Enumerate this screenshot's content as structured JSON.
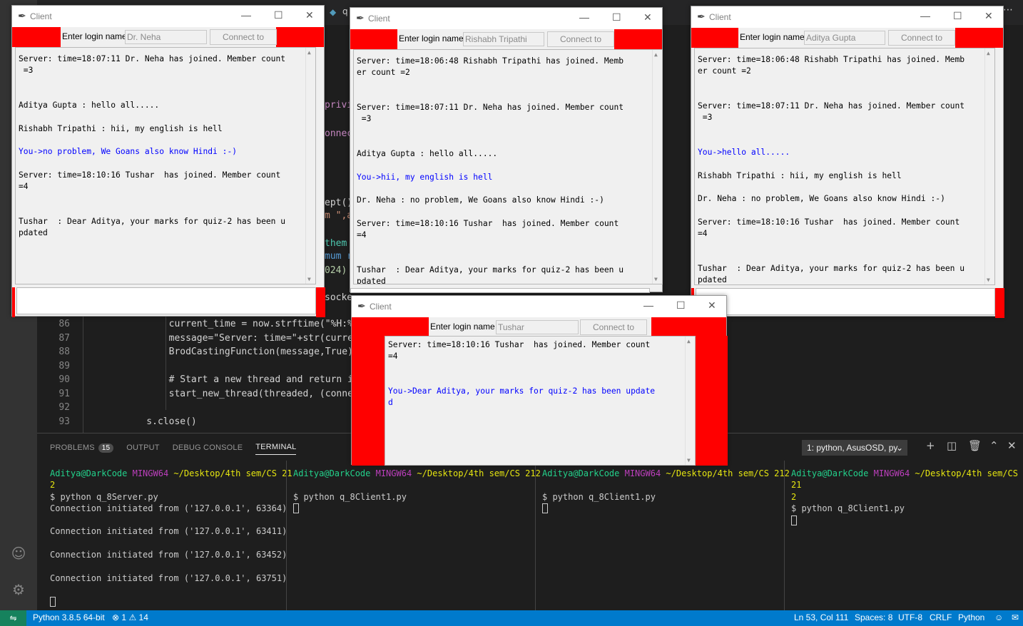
{
  "vscode": {
    "partial_tab": "q",
    "code_lines": [
      {
        "num": "86",
        "text": "        current_time = now.strftime(\"%H:%M:%"
      },
      {
        "num": "87",
        "text": "        message=\"Server: time=\"+str(current_"
      },
      {
        "num": "88",
        "text": "        BrodCastingFunction(message,True)"
      },
      {
        "num": "89",
        "text": ""
      },
      {
        "num": "90",
        "text": "        # Start a new thread and return its"
      },
      {
        "num": "91",
        "text": "        start_new_thread(threaded, (connecti"
      },
      {
        "num": "92",
        "text": ""
      },
      {
        "num": "93",
        "text": "    s.close()"
      }
    ],
    "peek_fragments": [
      "privi",
      "onnec",
      "ept()",
      "m \",a",
      "them",
      "mum r",
      "024)",
      "socke"
    ],
    "panel": {
      "tabs": [
        {
          "label": "PROBLEMS",
          "badge": "15"
        },
        {
          "label": "OUTPUT"
        },
        {
          "label": "DEBUG CONSOLE"
        },
        {
          "label": "TERMINAL"
        }
      ],
      "terminal_select": "1: python, AsusOSD, py",
      "icons": [
        "plus-icon",
        "split-icon",
        "trash-icon",
        "chevron-up-icon",
        "close-icon"
      ]
    },
    "terminals": [
      {
        "user": "Aditya@DarkCode",
        "env": "MINGW64",
        "path": "~/Desktop/4th sem/CS 21",
        "path_wrap": "2",
        "command": "$ python q_8Server.py",
        "output": [
          "Connection initiated from  ('127.0.0.1', 63364)",
          "Connection initiated from  ('127.0.0.1', 63411)",
          "Connection initiated from  ('127.0.0.1', 63452)",
          "Connection initiated from  ('127.0.0.1', 63751)"
        ]
      },
      {
        "user": "Aditya@DarkCode",
        "env": "MINGW64",
        "path": "~/Desktop/4th sem/CS 212",
        "command": "$ python q_8Client1.py"
      },
      {
        "user": "Aditya@DarkCode",
        "env": "MINGW64",
        "path": "~/Desktop/4th sem/CS 212",
        "command": "$ python q_8Client1.py"
      },
      {
        "user": "Aditya@DarkCode",
        "env": "MINGW64",
        "path": "~/Desktop/4th sem/CS 21",
        "path_wrap": "2",
        "command": "$ python q_8Client1.py"
      }
    ],
    "status": {
      "python": "Python 3.8.5 64-bit",
      "errors": "1",
      "warnings": "14",
      "position": "Ln 53, Col 111",
      "spaces": "Spaces: 8",
      "encoding": "UTF-8",
      "eol": "CRLF",
      "language": "Python"
    }
  },
  "client_common": {
    "title": "Client",
    "login_label": "Enter login name",
    "connect_label": "Connect to server"
  },
  "clients": [
    {
      "login_value": "Dr. Neha",
      "lines": [
        {
          "t": "Server: time=18:07:11 Dr. Neha has joined. Member count"
        },
        {
          "t": " =3"
        },
        {
          "t": ""
        },
        {
          "t": ""
        },
        {
          "t": "Aditya Gupta : hello all....."
        },
        {
          "t": ""
        },
        {
          "t": "Rishabh Tripathi : hii, my english is hell"
        },
        {
          "t": ""
        },
        {
          "t": "You->no problem, We Goans also know Hindi :-)",
          "you": true
        },
        {
          "t": ""
        },
        {
          "t": "Server: time=18:10:16 Tushar  has joined. Member count"
        },
        {
          "t": "=4"
        },
        {
          "t": ""
        },
        {
          "t": ""
        },
        {
          "t": "Tushar  : Dear Aditya, your marks for quiz-2 has been u"
        },
        {
          "t": "pdated"
        }
      ]
    },
    {
      "login_value": "Rishabh Tripathi",
      "lines": [
        {
          "t": "Server: time=18:06:48 Rishabh Tripathi has joined. Memb"
        },
        {
          "t": "er count =2"
        },
        {
          "t": ""
        },
        {
          "t": ""
        },
        {
          "t": "Server: time=18:07:11 Dr. Neha has joined. Member count"
        },
        {
          "t": " =3"
        },
        {
          "t": ""
        },
        {
          "t": ""
        },
        {
          "t": "Aditya Gupta : hello all....."
        },
        {
          "t": ""
        },
        {
          "t": "You->hii, my english is hell",
          "you": true
        },
        {
          "t": ""
        },
        {
          "t": "Dr. Neha : no problem, We Goans also know Hindi :-)"
        },
        {
          "t": ""
        },
        {
          "t": "Server: time=18:10:16 Tushar  has joined. Member count"
        },
        {
          "t": "=4"
        },
        {
          "t": ""
        },
        {
          "t": ""
        },
        {
          "t": "Tushar  : Dear Aditya, your marks for quiz-2 has been u"
        },
        {
          "t": "pdated"
        }
      ]
    },
    {
      "login_value": "Aditya Gupta",
      "lines": [
        {
          "t": "Server: time=18:06:48 Rishabh Tripathi has joined. Memb"
        },
        {
          "t": "er count =2"
        },
        {
          "t": ""
        },
        {
          "t": ""
        },
        {
          "t": "Server: time=18:07:11 Dr. Neha has joined. Member count"
        },
        {
          "t": " =3"
        },
        {
          "t": ""
        },
        {
          "t": ""
        },
        {
          "t": "You->hello all.....",
          "you": true
        },
        {
          "t": ""
        },
        {
          "t": "Rishabh Tripathi : hii, my english is hell"
        },
        {
          "t": ""
        },
        {
          "t": "Dr. Neha : no problem, We Goans also know Hindi :-)"
        },
        {
          "t": ""
        },
        {
          "t": "Server: time=18:10:16 Tushar  has joined. Member count"
        },
        {
          "t": "=4"
        },
        {
          "t": ""
        },
        {
          "t": ""
        },
        {
          "t": "Tushar  : Dear Aditya, your marks for quiz-2 has been u"
        },
        {
          "t": "pdated"
        }
      ]
    },
    {
      "login_value": "Tushar",
      "lines": [
        {
          "t": "Server: time=18:10:16 Tushar  has joined. Member count"
        },
        {
          "t": "=4"
        },
        {
          "t": ""
        },
        {
          "t": ""
        },
        {
          "t": "You->Dear Aditya, your marks for quiz-2 has been update",
          "you": true
        },
        {
          "t": "d",
          "you": true
        }
      ]
    }
  ]
}
